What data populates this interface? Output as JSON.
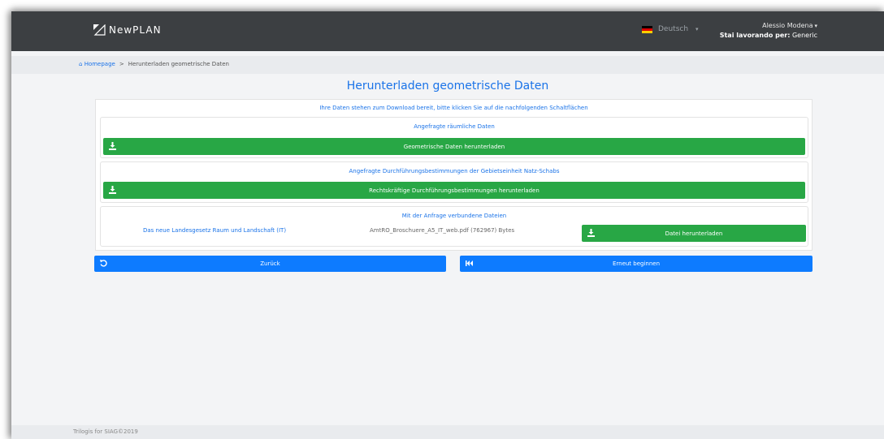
{
  "header": {
    "brand": "NewPLAN",
    "language": "Deutsch",
    "user_name": "Alessio Modena",
    "working_for_label": "Stai lavorando per:",
    "working_for_value": "Generic"
  },
  "breadcrumb": {
    "home": "Homepage",
    "separator": ">",
    "current": "Herunterladen geometrische Daten"
  },
  "main": {
    "title": "Herunterladen geometrische Daten",
    "intro": "Ihre Daten stehen zum Download bereit, bitte klicken Sie auf die nachfolgenden Schaltflächen",
    "spatial": {
      "title": "Angefragte räumliche Daten",
      "button": "Geometrische Daten herunterladen"
    },
    "regulations": {
      "title": "Angefragte Durchführungsbestimmungen der Gebietseinheit Natz-Schabs",
      "button": "Rechtskräftige Durchführungsbestimmungen herunterladen"
    },
    "files": {
      "title": "Mit der Anfrage verbundene Dateien",
      "link": "Das neue Landesgesetz Raum und Landschaft (IT)",
      "info": "AmtRO_Broschuere_A5_IT_web.pdf (762967) Bytes",
      "button": "Datei herunterladen"
    },
    "back_button": "Zurück",
    "restart_button": "Erneut beginnen"
  },
  "footer": {
    "text": "Trilogis for SIAG©2019"
  },
  "colors": {
    "navbar": "#3c3f42",
    "accent": "#1a73e8",
    "success": "#28a745",
    "primary": "#0d7bff"
  },
  "icons": {
    "logo": "newplan-logo-icon",
    "download": "download-icon",
    "back": "undo-icon",
    "restart": "skip-back-icon",
    "home": "home-icon",
    "caret": "caret-down-icon"
  }
}
